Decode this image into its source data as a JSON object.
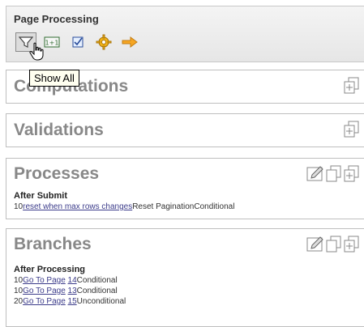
{
  "toolbar": {
    "title": "Page Processing",
    "icons": [
      "filter-icon",
      "one-plus-one-icon",
      "checkbox-icon",
      "gear-icon",
      "arrow-right-icon"
    ],
    "tooltip": "Show All"
  },
  "sections": {
    "computations": {
      "title": "Computations"
    },
    "validations": {
      "title": "Validations"
    },
    "processes": {
      "title": "Processes",
      "subheading": "After Submit",
      "rows": [
        {
          "seq": "10",
          "link": "reset when max rows changes",
          "type": "Reset Pagination",
          "condition": "Conditional"
        }
      ]
    },
    "branches": {
      "title": "Branches",
      "subheading": "After Processing",
      "rows": [
        {
          "seq": "10",
          "link": "Go To Page",
          "page": "14",
          "condition": "Conditional"
        },
        {
          "seq": "10",
          "link": "Go To Page",
          "page": "13",
          "condition": "Conditional"
        },
        {
          "seq": "20",
          "link": "Go To Page",
          "page": "15",
          "condition": "Unconditional"
        }
      ]
    }
  },
  "colors": {
    "toolbar_bg": "#e9e9e9",
    "title_gray": "#888888",
    "link": "#3b3b8a",
    "tooltip_bg": "#fffff0"
  }
}
